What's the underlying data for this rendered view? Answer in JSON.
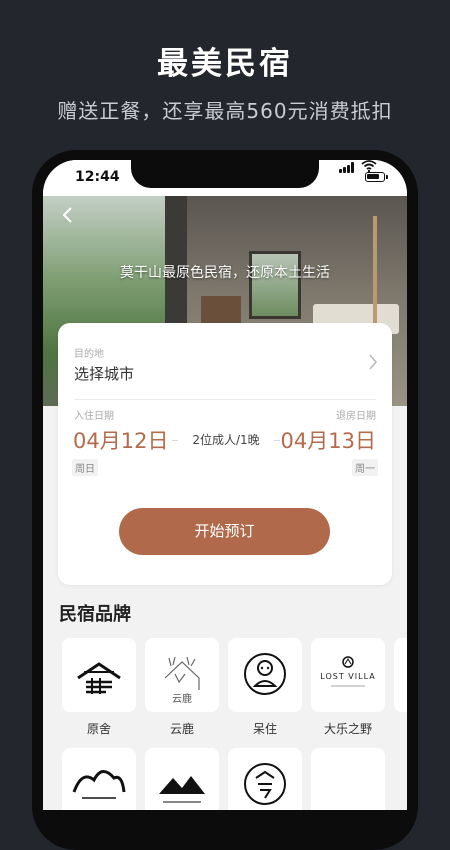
{
  "promo": {
    "title": "最美民宿",
    "subtitle": "赠送正餐，还享最高560元消费抵扣"
  },
  "status_bar": {
    "time": "12:44"
  },
  "hero": {
    "caption": "莫干山最原色民宿，还原本土生活"
  },
  "booking": {
    "destination_label": "目的地",
    "destination_value": "选择城市",
    "checkin_label": "入住日期",
    "checkout_label": "退房日期",
    "checkin_date": "04月12日",
    "checkout_date": "04月13日",
    "guests": "2位成人/1晚",
    "checkin_weekday": "周日",
    "checkout_weekday": "周一",
    "book_button": "开始预订"
  },
  "brands": {
    "title": "民宿品牌",
    "items": [
      {
        "name": "原舍",
        "icon": "yuanshe-logo"
      },
      {
        "name": "云鹿",
        "icon": "yunlu-logo",
        "logo_text": "云鹿"
      },
      {
        "name": "呆住",
        "icon": "daizhu-logo"
      },
      {
        "name": "大乐之野",
        "icon": "lost-villa-logo",
        "logo_text": "LOST VILLA"
      }
    ],
    "row2": [
      {
        "icon": "mountain-logo"
      },
      {
        "icon": "shangshu-logo"
      },
      {
        "icon": "seal-logo"
      }
    ]
  },
  "colors": {
    "background": "#23262d",
    "accent": "#b06a4b",
    "date_text": "#b46b4c"
  }
}
